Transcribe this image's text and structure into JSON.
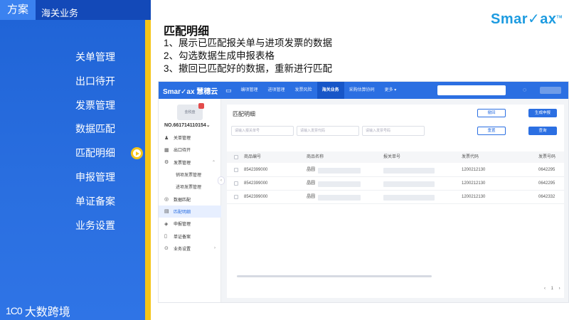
{
  "slide": {
    "tag": "方案",
    "section": "海关业务",
    "title": "匹配明细",
    "steps": [
      "1、展示已匹配报关单与进项发票的数据",
      "2、勾选数据生成申报表格",
      "3、撤回已匹配好的数据，重新进行匹配"
    ],
    "menu": [
      "关单管理",
      "出口待开",
      "发票管理",
      "数据匹配",
      "匹配明细",
      "申报管理",
      "单证备案",
      "业务设置"
    ],
    "active_menu": "匹配明细",
    "brand_top": "Smar✓ax",
    "brand_bottom": "大数跨境",
    "brand_bottom_mark": "1C0",
    "colors": {
      "primary_blue": "#2b6fe2",
      "panel_blue": "#1f63d6",
      "accent_yellow": "#f5c518",
      "brand_cyan": "#1d9be0"
    }
  },
  "app": {
    "logo": "Smar✓ax 慧穗云",
    "nav": [
      "编项管理",
      "进项管理",
      "发票风险",
      "海关业务",
      "采购估算协同",
      "更多 ▾"
    ],
    "active_nav": "海关业务",
    "company_card": "金税盘",
    "company_no": "NO.661714110154⌄",
    "side_menu": [
      {
        "label": "关单管理",
        "icon": "people-icon"
      },
      {
        "label": "出口待开",
        "icon": "calendar-icon"
      },
      {
        "label": "发票管理",
        "icon": "gear-icon",
        "expanded": true
      },
      {
        "label": "销项发票管理",
        "sub": true
      },
      {
        "label": "进项发票管理",
        "sub": true
      },
      {
        "label": "数据匹配",
        "icon": "match-icon"
      },
      {
        "label": "匹配明细",
        "icon": "list-icon",
        "active": true
      },
      {
        "label": "申报管理",
        "icon": "layers-icon"
      },
      {
        "label": "单证备案",
        "icon": "doc-icon"
      },
      {
        "label": "业务设置",
        "icon": "settings-icon",
        "chevron": true
      }
    ],
    "page_title": "匹配明细",
    "buttons": {
      "recall": "撤回",
      "generate": "生成申报",
      "reset": "重置",
      "query": "查询"
    },
    "filters": [
      "请输入报关单号",
      "请输入发票代码",
      "请输入发票号码"
    ],
    "table": {
      "columns": [
        "商品编号",
        "商品名称",
        "报关单号",
        "发票代码",
        "发票号码"
      ],
      "rows": [
        {
          "code": "8542399000",
          "name": "晶圆",
          "inv_code": "1200212130",
          "inv_no": "0642295"
        },
        {
          "code": "8542399000",
          "name": "晶圆",
          "inv_code": "1200212130",
          "inv_no": "0642295"
        },
        {
          "code": "8542399000",
          "name": "晶圆",
          "inv_code": "1200212130",
          "inv_no": "0642332"
        }
      ]
    },
    "pager": "‹ 1 ›"
  }
}
